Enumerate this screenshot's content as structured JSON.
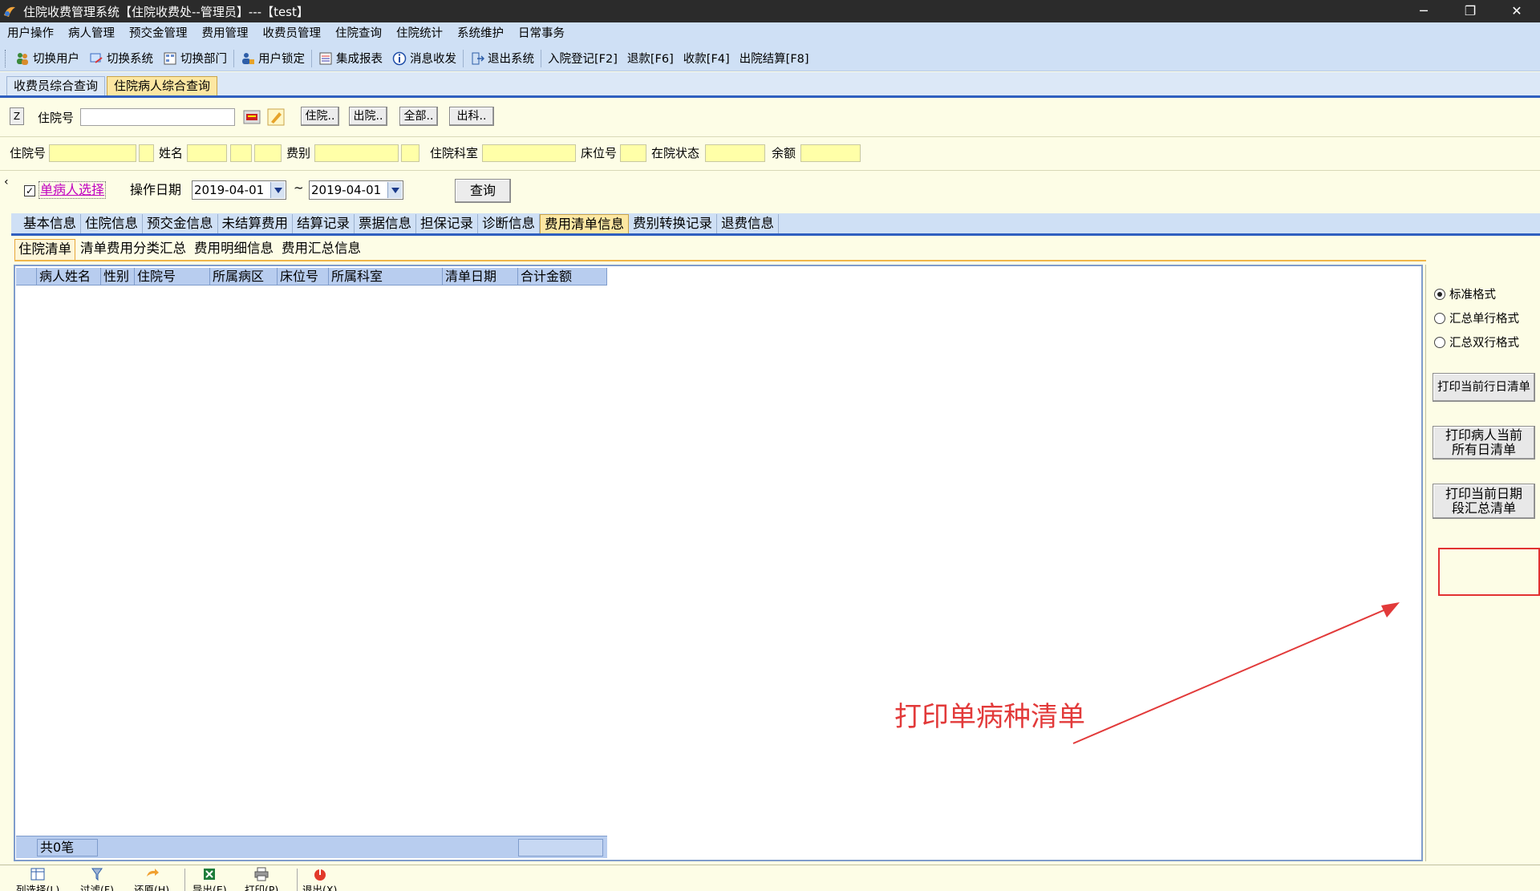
{
  "window": {
    "title": "住院收费管理系统【住院收费处--管理员】---【test】",
    "controls": [
      "─",
      "❐",
      "✕"
    ]
  },
  "menu": [
    "用户操作",
    "病人管理",
    "预交金管理",
    "费用管理",
    "收费员管理",
    "住院查询",
    "住院统计",
    "系统维护",
    "日常事务"
  ],
  "toolbar": {
    "switch_user": "切换用户",
    "switch_system": "切换系统",
    "switch_dept": "切换部门",
    "lock_user": "用户锁定",
    "report": "集成报表",
    "message": "消息收发",
    "exit": "退出系统",
    "admit": "入院登记[F2]",
    "refund": "退款[F6]",
    "charge": "收款[F4]",
    "discharge": "出院结算[F8]"
  },
  "doc_tabs": [
    "收费员综合查询",
    "住院病人综合查询"
  ],
  "form1": {
    "z_label": "Z",
    "inpatient_no_label": "住院号",
    "inpatient_no_value": "",
    "btn_in": "住院..",
    "btn_out": "出院..",
    "btn_all": "全部..",
    "btn_dept": "出科.."
  },
  "form2": {
    "inpatient_no": "住院号",
    "name": "姓名",
    "fee_type": "费别",
    "dept": "住院科室",
    "bed": "床位号",
    "status": "在院状态",
    "balance": "余额"
  },
  "form3": {
    "arrow": "‹",
    "checkbox_checked": "✓",
    "single_patient": "单病人选择",
    "op_date_label": "操作日期",
    "date_from": "2019-04-01",
    "tilde": "~",
    "date_to": "2019-04-01",
    "query_btn": "查询"
  },
  "info_tabs": [
    "基本信息",
    "住院信息",
    "预交金信息",
    "未结算费用",
    "结算记录",
    "票据信息",
    "担保记录",
    "诊断信息",
    "费用清单信息",
    "费别转换记录",
    "退费信息"
  ],
  "sub_tabs": [
    "住院清单",
    "清单费用分类汇总",
    "费用明细信息",
    "费用汇总信息"
  ],
  "grid": {
    "columns": [
      "病人姓名",
      "性别",
      "住院号",
      "所属病区",
      "床位号",
      "所属科室",
      "清单日期",
      "合计金额"
    ],
    "footer_count": "共0笔"
  },
  "right": {
    "radio_standard": "标准格式",
    "radio_single": "汇总单行格式",
    "radio_double": "汇总双行格式",
    "btn_print_day": "打印当前行日清单",
    "btn_print_all_1": "打印病人当前",
    "btn_print_all_2": "所有日清单",
    "btn_print_range_1": "打印当前日期",
    "btn_print_range_2": "段汇总清单"
  },
  "annotation": "打印单病种清单",
  "bottom": {
    "columns": "列选择(L)",
    "filter": "过滤(F)",
    "restore": "还原(H)",
    "export": "导出(E)",
    "print": "打印(P)",
    "exit": "退出(X)"
  },
  "colors": {
    "annotation_red": "#e23a3a",
    "tab_active": "#fde7a2",
    "input_yellow": "#ffffa8",
    "accent_blue": "#2f5fbf"
  }
}
